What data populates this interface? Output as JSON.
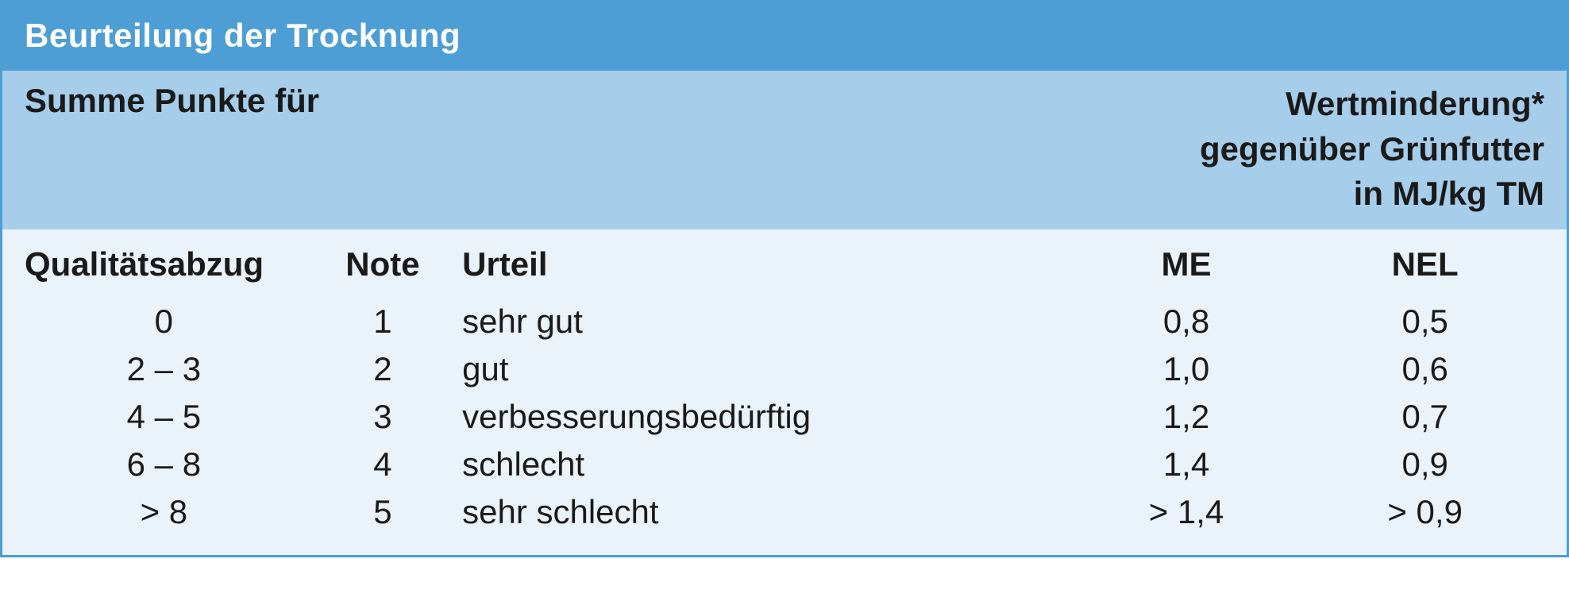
{
  "title": "Beurteilung der Trocknung",
  "header": {
    "left": "Summe Punkte für",
    "right_line1": "Wertminderung*",
    "right_line2": "gegenüber Grünfutter",
    "right_line3": "in MJ/kg TM"
  },
  "columns": {
    "qual": "Qualitätsabzug",
    "note": "Note",
    "urteil": "Urteil",
    "me": "ME",
    "nel": "NEL"
  },
  "rows": [
    {
      "qual": "0",
      "note": "1",
      "urteil": "sehr gut",
      "me": "0,8",
      "nel": "0,5"
    },
    {
      "qual": "2 – 3",
      "note": "2",
      "urteil": "gut",
      "me": "1,0",
      "nel": "0,6"
    },
    {
      "qual": "4 – 5",
      "note": "3",
      "urteil": "verbesserungsbedürftig",
      "me": "1,2",
      "nel": "0,7"
    },
    {
      "qual": "6 – 8",
      "note": "4",
      "urteil": "schlecht",
      "me": "1,4",
      "nel": "0,9"
    },
    {
      "qual": "> 8",
      "note": "5",
      "urteil": "sehr schlecht",
      "me": "> 1,4",
      "nel": "> 0,9"
    }
  ],
  "chart_data": {
    "type": "table",
    "title": "Beurteilung der Trocknung",
    "columns": [
      "Qualitätsabzug",
      "Note",
      "Urteil",
      "ME (MJ/kg TM)",
      "NEL (MJ/kg TM)"
    ],
    "rows": [
      [
        "0",
        1,
        "sehr gut",
        0.8,
        0.5
      ],
      [
        "2 – 3",
        2,
        "gut",
        1.0,
        0.6
      ],
      [
        "4 – 5",
        3,
        "verbesserungsbedürftig",
        1.2,
        0.7
      ],
      [
        "6 – 8",
        4,
        "schlecht",
        1.4,
        0.9
      ],
      [
        "> 8",
        5,
        "sehr schlecht",
        "> 1,4",
        "> 0,9"
      ]
    ]
  }
}
